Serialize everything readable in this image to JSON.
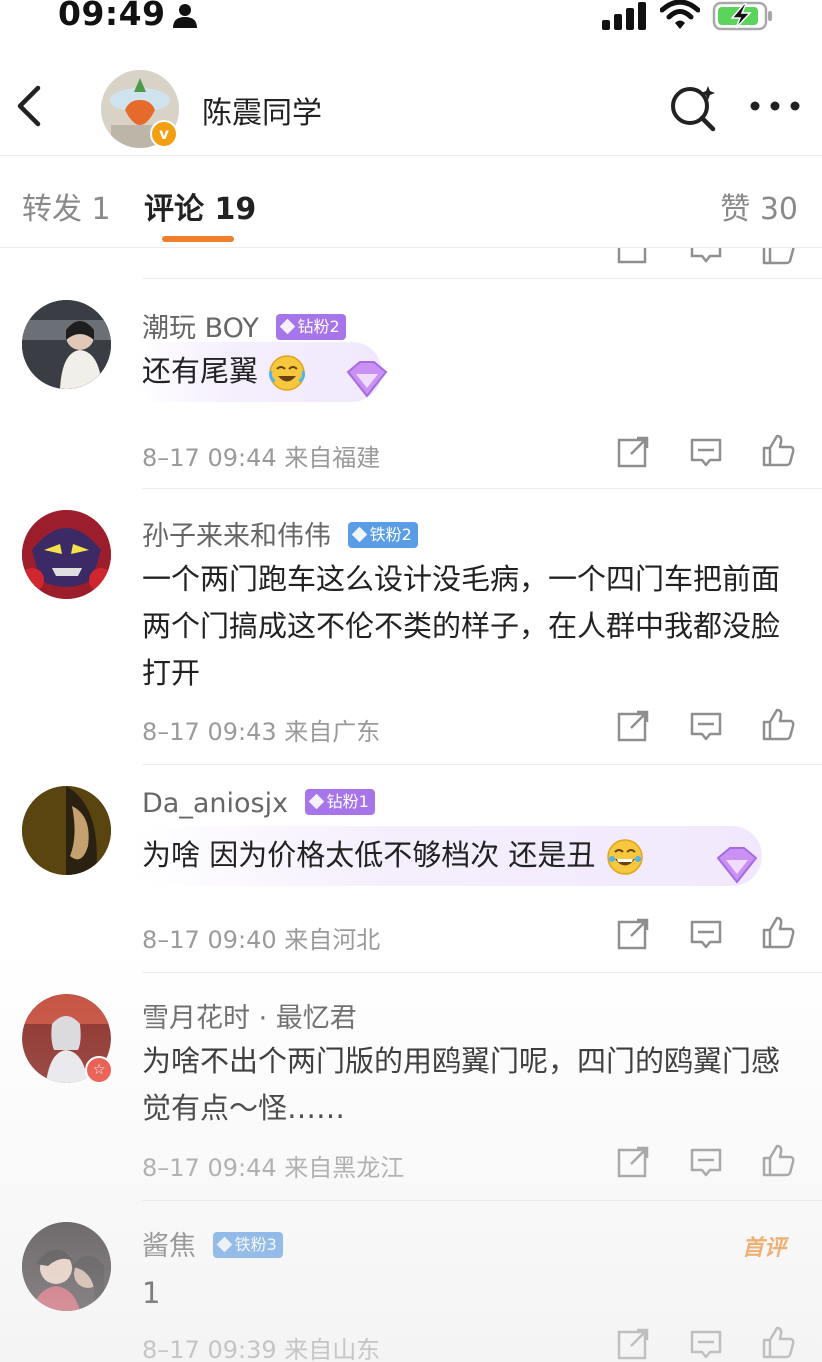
{
  "status_bar": {
    "time": "09:49",
    "icons": [
      "person-icon",
      "cellular-signal-icon",
      "wifi-icon",
      "battery-charging-icon"
    ]
  },
  "header": {
    "title": "陈震同学",
    "verified_mark": "v",
    "icons": [
      "back-icon",
      "search-icon",
      "more-icon"
    ]
  },
  "tabs": {
    "repost": "转发 1",
    "comment": "评论 19",
    "like": "赞 30",
    "accent": "#f07f2a"
  },
  "comments": [
    {
      "name": "潮玩 BOY",
      "badge": "钻粉2",
      "text": "还有尾翼",
      "emoji": "cry-laugh-emoji",
      "time": "8–17 09:44",
      "location": "来自福建"
    },
    {
      "name": "孙子来来和伟伟",
      "badge": "铁粉2",
      "text": "一个两门跑车这么设计没毛病，一个四门车把前面两个门搞成这不伦不类的样子，在人群中我都没脸打开",
      "time": "8–17 09:43",
      "location": "来自广东"
    },
    {
      "name": "Da_aniosjx",
      "badge": "钻粉1",
      "text": "为啥 因为价格太低不够档次 还是丑",
      "emoji": "grin-tears-emoji",
      "time": "8–17 09:40",
      "location": "来自河北"
    },
    {
      "name": "雪月花时 · 最忆君",
      "text": "为啥不出个两门版的用鸥翼门呢，四门的鸥翼门感觉有点～怪……",
      "time": "8–17 09:44",
      "location": "来自黑龙江"
    },
    {
      "name": "酱焦",
      "badge": "铁粉3",
      "tag": "首评",
      "text": "1",
      "time": "8–17 09:39",
      "location": "来自山东"
    }
  ],
  "colors": {
    "diamond_badge": "#a775ea",
    "iron_badge": "#5a9de6",
    "first_tag": "#f08a2a"
  }
}
